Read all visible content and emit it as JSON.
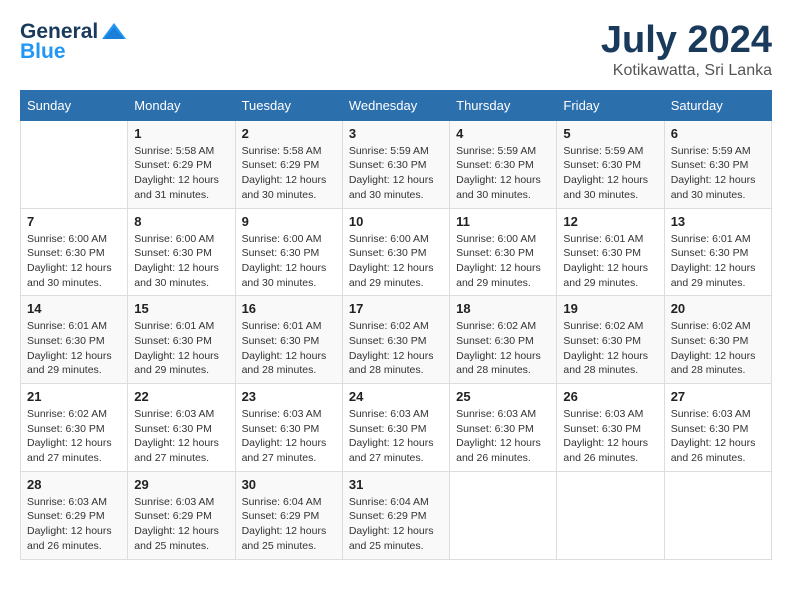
{
  "logo": {
    "line1": "General",
    "line2": "Blue"
  },
  "title": "July 2024",
  "subtitle": "Kotikawatta, Sri Lanka",
  "days_of_week": [
    "Sunday",
    "Monday",
    "Tuesday",
    "Wednesday",
    "Thursday",
    "Friday",
    "Saturday"
  ],
  "weeks": [
    [
      {
        "day": "",
        "info": ""
      },
      {
        "day": "1",
        "info": "Sunrise: 5:58 AM\nSunset: 6:29 PM\nDaylight: 12 hours\nand 31 minutes."
      },
      {
        "day": "2",
        "info": "Sunrise: 5:58 AM\nSunset: 6:29 PM\nDaylight: 12 hours\nand 30 minutes."
      },
      {
        "day": "3",
        "info": "Sunrise: 5:59 AM\nSunset: 6:30 PM\nDaylight: 12 hours\nand 30 minutes."
      },
      {
        "day": "4",
        "info": "Sunrise: 5:59 AM\nSunset: 6:30 PM\nDaylight: 12 hours\nand 30 minutes."
      },
      {
        "day": "5",
        "info": "Sunrise: 5:59 AM\nSunset: 6:30 PM\nDaylight: 12 hours\nand 30 minutes."
      },
      {
        "day": "6",
        "info": "Sunrise: 5:59 AM\nSunset: 6:30 PM\nDaylight: 12 hours\nand 30 minutes."
      }
    ],
    [
      {
        "day": "7",
        "info": "Sunrise: 6:00 AM\nSunset: 6:30 PM\nDaylight: 12 hours\nand 30 minutes."
      },
      {
        "day": "8",
        "info": "Sunrise: 6:00 AM\nSunset: 6:30 PM\nDaylight: 12 hours\nand 30 minutes."
      },
      {
        "day": "9",
        "info": "Sunrise: 6:00 AM\nSunset: 6:30 PM\nDaylight: 12 hours\nand 30 minutes."
      },
      {
        "day": "10",
        "info": "Sunrise: 6:00 AM\nSunset: 6:30 PM\nDaylight: 12 hours\nand 29 minutes."
      },
      {
        "day": "11",
        "info": "Sunrise: 6:00 AM\nSunset: 6:30 PM\nDaylight: 12 hours\nand 29 minutes."
      },
      {
        "day": "12",
        "info": "Sunrise: 6:01 AM\nSunset: 6:30 PM\nDaylight: 12 hours\nand 29 minutes."
      },
      {
        "day": "13",
        "info": "Sunrise: 6:01 AM\nSunset: 6:30 PM\nDaylight: 12 hours\nand 29 minutes."
      }
    ],
    [
      {
        "day": "14",
        "info": "Sunrise: 6:01 AM\nSunset: 6:30 PM\nDaylight: 12 hours\nand 29 minutes."
      },
      {
        "day": "15",
        "info": "Sunrise: 6:01 AM\nSunset: 6:30 PM\nDaylight: 12 hours\nand 29 minutes."
      },
      {
        "day": "16",
        "info": "Sunrise: 6:01 AM\nSunset: 6:30 PM\nDaylight: 12 hours\nand 28 minutes."
      },
      {
        "day": "17",
        "info": "Sunrise: 6:02 AM\nSunset: 6:30 PM\nDaylight: 12 hours\nand 28 minutes."
      },
      {
        "day": "18",
        "info": "Sunrise: 6:02 AM\nSunset: 6:30 PM\nDaylight: 12 hours\nand 28 minutes."
      },
      {
        "day": "19",
        "info": "Sunrise: 6:02 AM\nSunset: 6:30 PM\nDaylight: 12 hours\nand 28 minutes."
      },
      {
        "day": "20",
        "info": "Sunrise: 6:02 AM\nSunset: 6:30 PM\nDaylight: 12 hours\nand 28 minutes."
      }
    ],
    [
      {
        "day": "21",
        "info": "Sunrise: 6:02 AM\nSunset: 6:30 PM\nDaylight: 12 hours\nand 27 minutes."
      },
      {
        "day": "22",
        "info": "Sunrise: 6:03 AM\nSunset: 6:30 PM\nDaylight: 12 hours\nand 27 minutes."
      },
      {
        "day": "23",
        "info": "Sunrise: 6:03 AM\nSunset: 6:30 PM\nDaylight: 12 hours\nand 27 minutes."
      },
      {
        "day": "24",
        "info": "Sunrise: 6:03 AM\nSunset: 6:30 PM\nDaylight: 12 hours\nand 27 minutes."
      },
      {
        "day": "25",
        "info": "Sunrise: 6:03 AM\nSunset: 6:30 PM\nDaylight: 12 hours\nand 26 minutes."
      },
      {
        "day": "26",
        "info": "Sunrise: 6:03 AM\nSunset: 6:30 PM\nDaylight: 12 hours\nand 26 minutes."
      },
      {
        "day": "27",
        "info": "Sunrise: 6:03 AM\nSunset: 6:30 PM\nDaylight: 12 hours\nand 26 minutes."
      }
    ],
    [
      {
        "day": "28",
        "info": "Sunrise: 6:03 AM\nSunset: 6:29 PM\nDaylight: 12 hours\nand 26 minutes."
      },
      {
        "day": "29",
        "info": "Sunrise: 6:03 AM\nSunset: 6:29 PM\nDaylight: 12 hours\nand 25 minutes."
      },
      {
        "day": "30",
        "info": "Sunrise: 6:04 AM\nSunset: 6:29 PM\nDaylight: 12 hours\nand 25 minutes."
      },
      {
        "day": "31",
        "info": "Sunrise: 6:04 AM\nSunset: 6:29 PM\nDaylight: 12 hours\nand 25 minutes."
      },
      {
        "day": "",
        "info": ""
      },
      {
        "day": "",
        "info": ""
      },
      {
        "day": "",
        "info": ""
      }
    ]
  ]
}
